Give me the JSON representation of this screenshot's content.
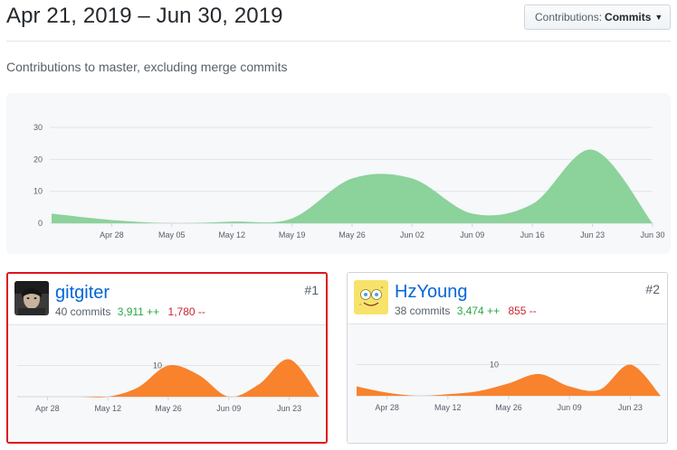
{
  "header": {
    "title": "Apr 21, 2019 – Jun 30, 2019",
    "select_label": "Contributions:",
    "select_value": "Commits"
  },
  "subtitle": "Contributions to master, excluding merge commits",
  "colors": {
    "main_area": "#8cd29b",
    "contributor_area": "#f9822d",
    "link": "#0366d6",
    "additions": "#28a745",
    "deletions": "#cb2431",
    "selected_outline": "#e0141e"
  },
  "chart_data": [
    {
      "type": "area",
      "y_ticks": [
        "30",
        "20",
        "10",
        "0"
      ],
      "ylim": [
        0,
        30
      ],
      "x_ticks": [
        "Apr 28",
        "May 05",
        "May 12",
        "May 19",
        "May 26",
        "Jun 02",
        "Jun 09",
        "Jun 16",
        "Jun 23",
        "Jun 30"
      ],
      "x": [
        "Apr 21",
        "Apr 28",
        "May 05",
        "May 12",
        "May 19",
        "May 26",
        "Jun 02",
        "Jun 09",
        "Jun 16",
        "Jun 23",
        "Jun 30"
      ],
      "values": [
        3,
        1,
        0,
        0.5,
        1.5,
        14,
        14,
        3,
        6,
        23,
        0
      ],
      "grid": true
    },
    {
      "type": "area",
      "y_ticks": [
        "10"
      ],
      "ylim": [
        0,
        20
      ],
      "x_ticks": [
        "Apr 28",
        "May 12",
        "May 26",
        "Jun 09",
        "Jun 23"
      ],
      "x": [
        "Apr 21",
        "Apr 28",
        "May 05",
        "May 12",
        "May 19",
        "May 26",
        "Jun 02",
        "Jun 09",
        "Jun 16",
        "Jun 23",
        "Jun 30"
      ],
      "values": [
        0,
        0,
        0,
        0,
        3,
        10,
        7,
        0,
        4,
        12,
        0
      ],
      "grid": true
    },
    {
      "type": "area",
      "y_ticks": [
        "10"
      ],
      "ylim": [
        0,
        20
      ],
      "x_ticks": [
        "Apr 28",
        "May 12",
        "May 26",
        "Jun 09",
        "Jun 23"
      ],
      "x": [
        "Apr 21",
        "Apr 28",
        "May 05",
        "May 12",
        "May 19",
        "May 26",
        "Jun 02",
        "Jun 09",
        "Jun 16",
        "Jun 23",
        "Jun 30"
      ],
      "values": [
        3,
        1,
        0,
        0.5,
        1.5,
        4,
        7,
        3,
        2,
        10,
        0
      ],
      "grid": true
    }
  ],
  "contributors": [
    {
      "name": "gitgiter",
      "commits": "40 commits",
      "additions": "3,911 ++",
      "deletions": "1,780 --",
      "rank": "#1",
      "avatar_icon": "user-photo-avatar-icon"
    },
    {
      "name": "HzYoung",
      "commits": "38 commits",
      "additions": "3,474 ++",
      "deletions": "855 --",
      "rank": "#2",
      "avatar_icon": "sponge-face-avatar-icon"
    }
  ]
}
